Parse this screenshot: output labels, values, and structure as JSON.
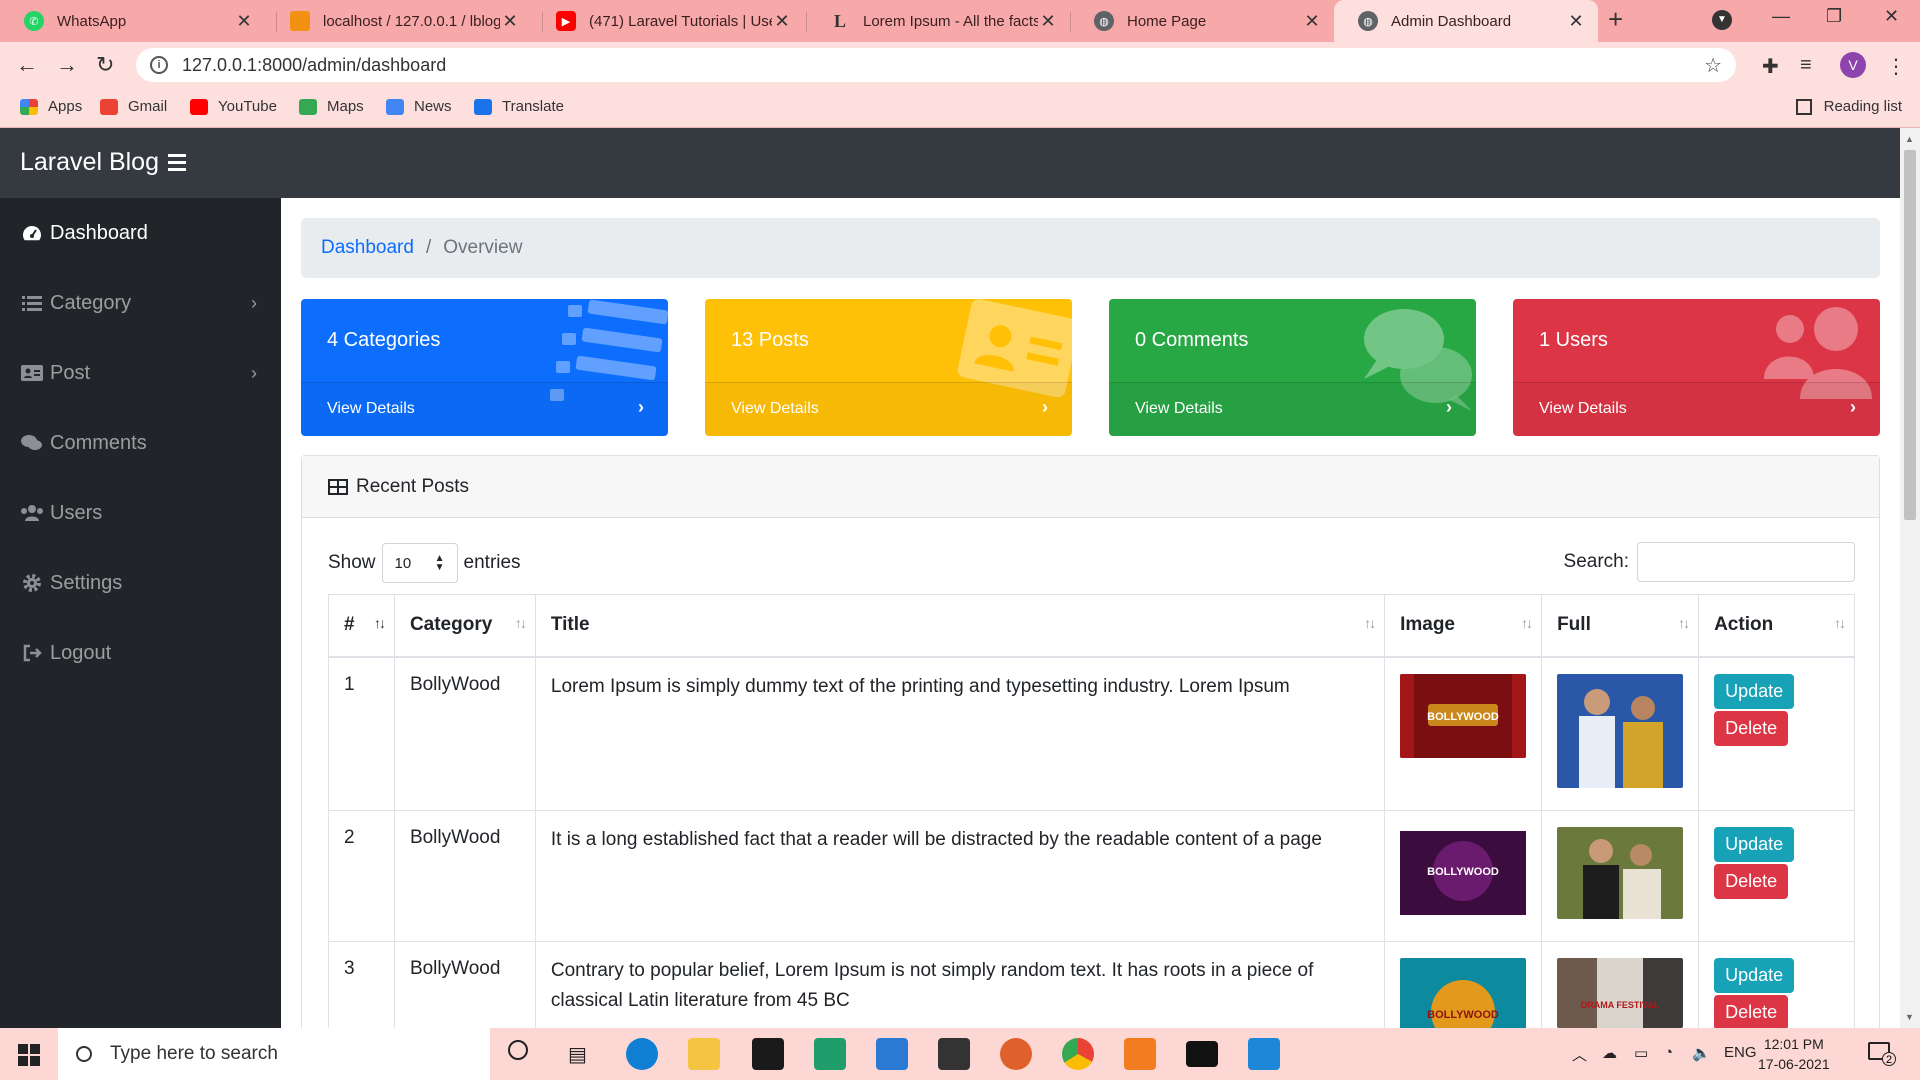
{
  "browser": {
    "tabs": [
      {
        "title": "WhatsApp",
        "color": "#25d366"
      },
      {
        "title": "localhost / 127.0.0.1 / lblog",
        "color": "#f29111"
      },
      {
        "title": "(471) Laravel Tutorials | Use",
        "color": "#ff0000"
      },
      {
        "title": "Lorem Ipsum - All the facts",
        "color": "#444444"
      },
      {
        "title": "Home Page",
        "color": "#5f6368"
      },
      {
        "title": "Admin Dashboard",
        "color": "#5f6368"
      }
    ],
    "url": "127.0.0.1:8000/admin/dashboard",
    "profile_initial": "V",
    "bookmarks": [
      {
        "label": "Apps",
        "color": "#4285f4"
      },
      {
        "label": "Gmail",
        "color": "#ea4335"
      },
      {
        "label": "YouTube",
        "color": "#ff0000"
      },
      {
        "label": "Maps",
        "color": "#34a853"
      },
      {
        "label": "News",
        "color": "#4285f4"
      },
      {
        "label": "Translate",
        "color": "#1a73e8"
      }
    ],
    "reading_list": "Reading list"
  },
  "app": {
    "brand": "Laravel Blog",
    "sidebar": [
      {
        "label": "Dashboard",
        "icon": "tachometer-icon",
        "active": true,
        "chevron": false
      },
      {
        "label": "Category",
        "icon": "list-icon",
        "active": false,
        "chevron": true
      },
      {
        "label": "Post",
        "icon": "id-card-icon",
        "active": false,
        "chevron": true
      },
      {
        "label": "Comments",
        "icon": "comments-icon",
        "active": false,
        "chevron": false
      },
      {
        "label": "Users",
        "icon": "users-icon",
        "active": false,
        "chevron": false
      },
      {
        "label": "Settings",
        "icon": "gear-icon",
        "active": false,
        "chevron": false
      },
      {
        "label": "Logout",
        "icon": "sign-out-icon",
        "active": false,
        "chevron": false
      }
    ],
    "breadcrumb": {
      "link": "Dashboard",
      "current": "Overview"
    },
    "cards": [
      {
        "title": "4 Categories",
        "link": "View Details",
        "color": "#0d6efd",
        "icon": "list-icon"
      },
      {
        "title": "13 Posts",
        "link": "View Details",
        "color": "#ffc107",
        "icon": "id-card-icon"
      },
      {
        "title": "0 Comments",
        "link": "View Details",
        "color": "#28a745",
        "icon": "comments-icon"
      },
      {
        "title": "1 Users",
        "link": "View Details",
        "color": "#dc3545",
        "icon": "users-icon"
      }
    ],
    "recent": {
      "heading": "Recent Posts",
      "show_label": "Show",
      "entries_value": "10",
      "entries_label": "entries",
      "search_label": "Search:",
      "columns": [
        "#",
        "Category",
        "Title",
        "Image",
        "Full",
        "Action"
      ],
      "rows": [
        {
          "num": "1",
          "category": "BollyWood",
          "title": "Lorem Ipsum is simply dummy text of the printing and typesetting industry. Lorem Ipsum",
          "image_label": "BOLLYWOOD"
        },
        {
          "num": "2",
          "category": "BollyWood",
          "title": "It is a long established fact that a reader will be distracted by the readable content of a page",
          "image_label": "BOLLYWOOD"
        },
        {
          "num": "3",
          "category": "BollyWood",
          "title": "Contrary to popular belief, Lorem Ipsum is not simply random text. It has roots in a piece of classical Latin literature from 45 BC",
          "image_label": "BOLLYWOOD",
          "full_label": "DRAMA FESTIVAL"
        }
      ],
      "update_label": "Update",
      "delete_label": "Delete"
    }
  },
  "taskbar": {
    "search_placeholder": "Type here to search",
    "lang": "ENG",
    "time": "12:01 PM",
    "date": "17-06-2021",
    "notifications": "2"
  }
}
